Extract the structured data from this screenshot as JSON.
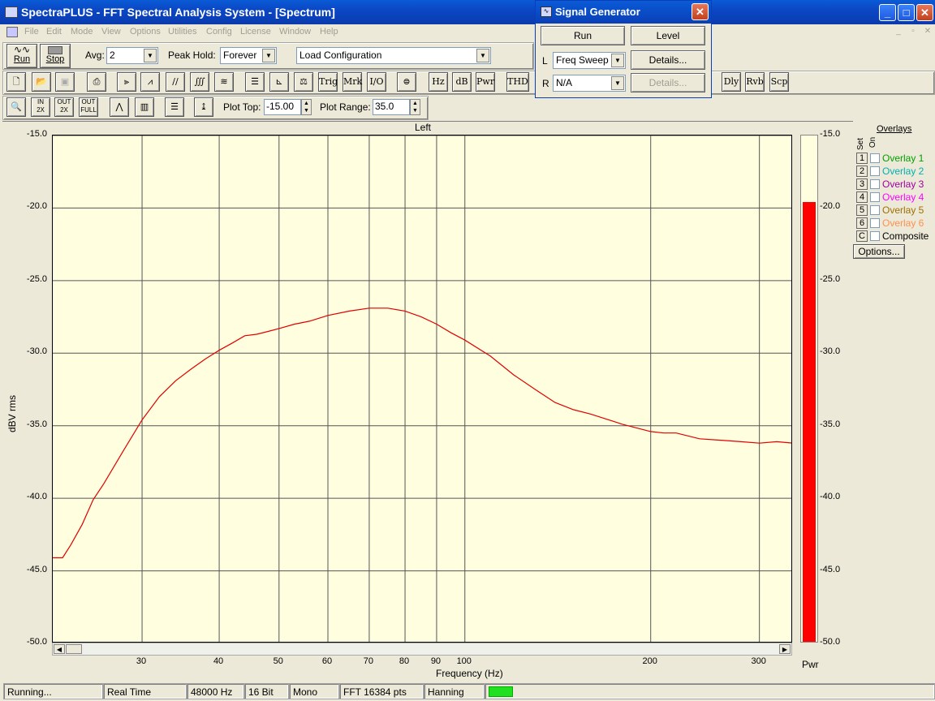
{
  "window": {
    "title": "SpectraPLUS - FFT Spectral Analysis System - [Spectrum]"
  },
  "menu": [
    "File",
    "Edit",
    "Mode",
    "View",
    "Options",
    "Utilities",
    "Config",
    "License",
    "Window",
    "Help"
  ],
  "toolbar1": {
    "run_label": "Run",
    "stop_label": "Stop",
    "avg_label": "Avg:",
    "avg_value": "2",
    "peak_label": "Peak Hold:",
    "peak_value": "Forever",
    "config_value": "Load Configuration"
  },
  "toolbar2": {
    "text_buttons": [
      "Trig",
      "Mrk",
      "I/O",
      "Hz",
      "dB",
      "Pwr",
      "THD",
      "Dly",
      "Rvb",
      "Scp"
    ]
  },
  "toolbar3": {
    "plot_top_label": "Plot Top:",
    "plot_top_value": "-15.00",
    "plot_range_label": "Plot Range:",
    "plot_range_value": "35.0",
    "zoom_labels": [
      "IN",
      "2X",
      "OUT",
      "2X",
      "OUT",
      "FULL"
    ]
  },
  "signal_generator": {
    "title": "Signal Generator",
    "run_label": "Run",
    "level_label": "Level",
    "l_label": "L",
    "l_value": "Freq Sweep",
    "l_details": "Details...",
    "r_label": "R",
    "r_value": "N/A",
    "r_details": "Details..."
  },
  "chart_data": {
    "type": "line",
    "title": "Left",
    "xlabel": "Frequency (Hz)",
    "ylabel": "dBV rms",
    "xscale": "log",
    "xlim": [
      21.5,
      340
    ],
    "ylim": [
      -50,
      -15
    ],
    "yticks": [
      "-15.0",
      "-20.0",
      "-25.0",
      "-30.0",
      "-35.0",
      "-40.0",
      "-45.0",
      "-50.0"
    ],
    "xticks": [
      "30",
      "40",
      "50",
      "60",
      "70",
      "80",
      "90",
      "100",
      "200",
      "300"
    ],
    "grid": true,
    "series": [
      {
        "color": "#e00000",
        "x": [
          21.5,
          22.3,
          23,
          24,
          25,
          26,
          28,
          30,
          32,
          34,
          36,
          38,
          40,
          42,
          44,
          46,
          48,
          50,
          53,
          56,
          60,
          65,
          70,
          75,
          80,
          85,
          90,
          95,
          100,
          110,
          120,
          130,
          140,
          150,
          160,
          180,
          200,
          210,
          220,
          240,
          260,
          280,
          300,
          320,
          340
        ],
        "y": [
          -44.1,
          -44.1,
          -43.2,
          -41.8,
          -40.1,
          -39.0,
          -36.7,
          -34.6,
          -33.0,
          -31.9,
          -31.1,
          -30.4,
          -29.8,
          -29.3,
          -28.8,
          -28.7,
          -28.5,
          -28.3,
          -28.0,
          -27.8,
          -27.4,
          -27.1,
          -26.9,
          -26.9,
          -27.1,
          -27.5,
          -28.0,
          -28.6,
          -29.1,
          -30.2,
          -31.5,
          -32.5,
          -33.4,
          -33.9,
          -34.2,
          -34.9,
          -35.4,
          -35.5,
          -35.5,
          -35.9,
          -36.0,
          -36.1,
          -36.2,
          -36.1,
          -36.2
        ]
      }
    ]
  },
  "pwr_meter": {
    "label": "Pwr",
    "value": -19.6,
    "range": [
      -50,
      -15
    ],
    "color": "#ff0000",
    "ticks": [
      "-15.0",
      "-20.0",
      "-25.0",
      "-30.0",
      "-35.0",
      "-40.0",
      "-45.0",
      "-50.0"
    ]
  },
  "overlays": {
    "title": "Overlays",
    "set_label": "Set",
    "on_label": "On",
    "items": [
      {
        "num": "1",
        "name": "Overlay 1",
        "color": "#00a000"
      },
      {
        "num": "2",
        "name": "Overlay 2",
        "color": "#00b0b0"
      },
      {
        "num": "3",
        "name": "Overlay 3",
        "color": "#a000a0"
      },
      {
        "num": "4",
        "name": "Overlay 4",
        "color": "#ff00ff"
      },
      {
        "num": "5",
        "name": "Overlay 5",
        "color": "#a07000"
      },
      {
        "num": "6",
        "name": "Overlay 6",
        "color": "#ff9050"
      },
      {
        "num": "C",
        "name": "Composite",
        "color": "#000000"
      }
    ],
    "options_label": "Options..."
  },
  "status": [
    "Running...",
    "Real Time",
    "48000 Hz",
    "16 Bit",
    "Mono",
    "FFT 16384 pts",
    "Hanning"
  ]
}
